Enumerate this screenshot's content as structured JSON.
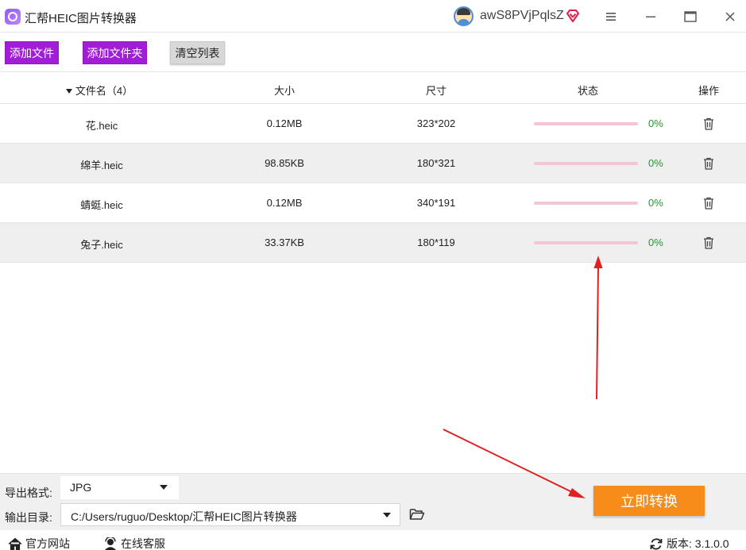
{
  "app": {
    "title": "汇帮HEIC图片转换器",
    "username": "awS8PVjPqlsZ"
  },
  "toolbar": {
    "add_file_label": "添加文件",
    "add_folder_label": "添加文件夹",
    "clear_label": "清空列表"
  },
  "table": {
    "headers": {
      "name": "文件名（4）",
      "size": "大小",
      "dimensions": "尺寸",
      "status": "状态",
      "operation": "操作"
    },
    "rows": [
      {
        "name": "花.heic",
        "size": "0.12MB",
        "dimensions": "323*202",
        "progress_text": "0%",
        "progress": 0
      },
      {
        "name": "绵羊.heic",
        "size": "98.85KB",
        "dimensions": "180*321",
        "progress_text": "0%",
        "progress": 0
      },
      {
        "name": "蜻蜓.heic",
        "size": "0.12MB",
        "dimensions": "340*191",
        "progress_text": "0%",
        "progress": 0
      },
      {
        "name": "兔子.heic",
        "size": "33.37KB",
        "dimensions": "180*119",
        "progress_text": "0%",
        "progress": 0
      }
    ]
  },
  "settings": {
    "format_label": "导出格式:",
    "format_value": "JPG",
    "dir_label": "输出目录:",
    "dir_value": "C:/Users/ruguo/Desktop/汇帮HEIC图片转换器"
  },
  "convert_label": "立即转换",
  "footer": {
    "site_label": "官方网站",
    "service_label": "在线客服",
    "version_label": "版本:  3.1.0.0"
  },
  "colors": {
    "accent_purple": "#a21ed6",
    "convert_orange": "#f78c1a",
    "progress_pink": "#f4c6d3",
    "percent_green": "#1d9a2a",
    "annotation_red": "#e02020"
  }
}
